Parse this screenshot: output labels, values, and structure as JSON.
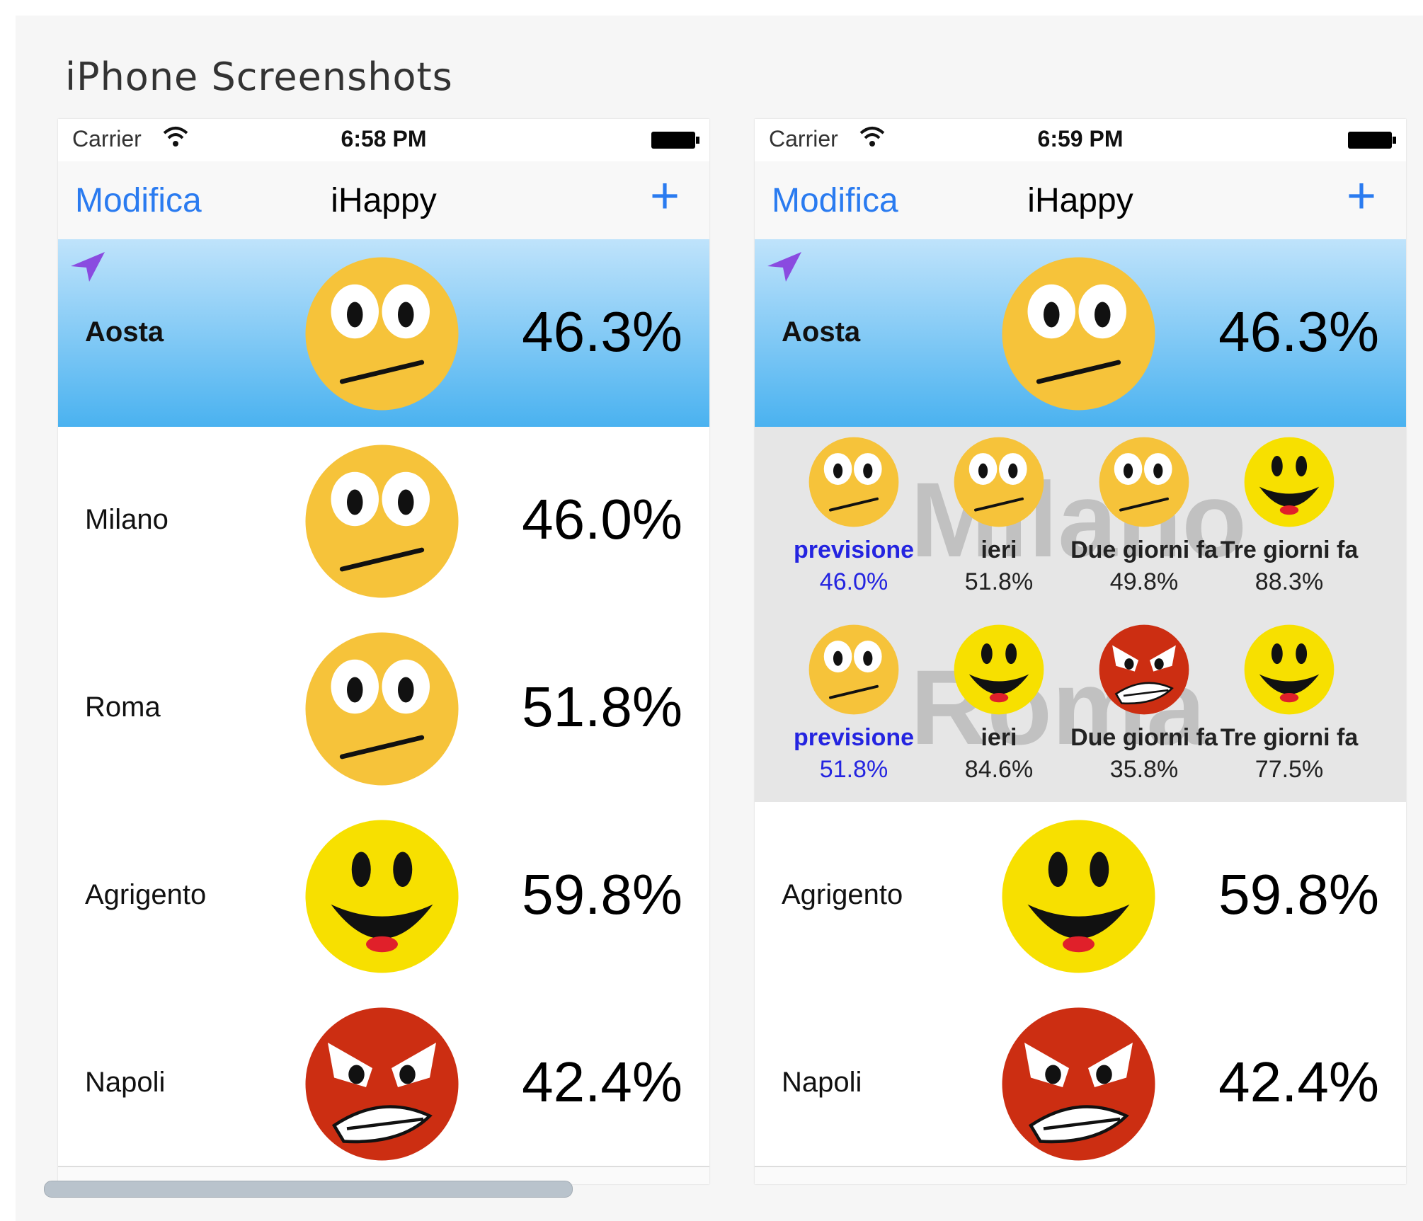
{
  "heading": "iPhone Screenshots",
  "colors": {
    "accent": "#2a7bf0",
    "forecast": "#2424e0",
    "selected_top": "#bfe3fb",
    "selected_bottom": "#4ab2f0",
    "face_neutral": "#f6c33a",
    "face_happy": "#f7e000",
    "face_angry": "#cc2e12"
  },
  "phones": [
    {
      "status": {
        "carrier": "Carrier",
        "time": "6:58 PM"
      },
      "nav": {
        "left": "Modifica",
        "title": "iHappy",
        "right": "+"
      },
      "rows": [
        {
          "city": "Aosta",
          "pct": "46.3%",
          "face": "neutral-face-icon",
          "selected": true
        },
        {
          "city": "Milano",
          "pct": "46.0%",
          "face": "neutral-face-icon"
        },
        {
          "city": "Roma",
          "pct": "51.8%",
          "face": "neutral-face-icon"
        },
        {
          "city": "Agrigento",
          "pct": "59.8%",
          "face": "happy-face-icon"
        },
        {
          "city": "Napoli",
          "pct": "42.4%",
          "face": "angry-face-icon"
        }
      ]
    },
    {
      "status": {
        "carrier": "Carrier",
        "time": "6:59 PM"
      },
      "nav": {
        "left": "Modifica",
        "title": "iHappy",
        "right": "+"
      },
      "rows": [
        {
          "city": "Aosta",
          "pct": "46.3%",
          "face": "neutral-face-icon",
          "selected": true
        },
        {
          "city": "Agrigento",
          "pct": "59.8%",
          "face": "happy-face-icon"
        },
        {
          "city": "Napoli",
          "pct": "42.4%",
          "face": "angry-face-icon"
        }
      ],
      "detail": [
        {
          "watermark": "Milano",
          "cells": [
            {
              "label": "previsione",
              "value": "46.0%",
              "face": "neutral-face-icon"
            },
            {
              "label": "ieri",
              "value": "51.8%",
              "face": "neutral-face-icon"
            },
            {
              "label": "Due giorni fa",
              "value": "49.8%",
              "face": "neutral-face-icon"
            },
            {
              "label": "Tre giorni fa",
              "value": "88.3%",
              "face": "happy-face-icon"
            }
          ]
        },
        {
          "watermark": "Roma",
          "cells": [
            {
              "label": "previsione",
              "value": "51.8%",
              "face": "neutral-face-icon"
            },
            {
              "label": "ieri",
              "value": "84.6%",
              "face": "happy-face-icon"
            },
            {
              "label": "Due giorni fa",
              "value": "35.8%",
              "face": "angry-face-icon"
            },
            {
              "label": "Tre giorni fa",
              "value": "77.5%",
              "face": "happy-face-icon"
            }
          ]
        }
      ]
    }
  ]
}
